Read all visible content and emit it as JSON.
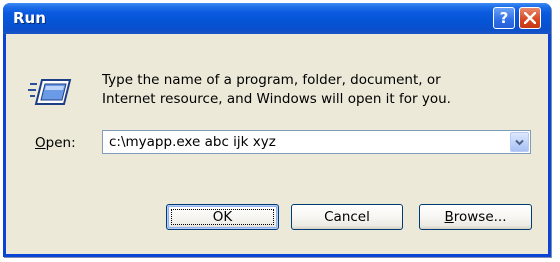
{
  "window": {
    "title": "Run",
    "help_glyph": "?",
    "close_icon": "close-icon"
  },
  "description": {
    "line1": "Type the name of a program, folder, document, or",
    "line2": "Internet resource, and Windows will open it for you."
  },
  "open_field": {
    "label_mnemonic": "O",
    "label_rest": "pen:",
    "value": "c:\\myapp.exe abc ijk xyz"
  },
  "buttons": {
    "ok": "OK",
    "cancel": "Cancel",
    "browse_mnemonic": "B",
    "browse_rest": "rowse..."
  },
  "colors": {
    "titlebar": "#0554d6",
    "client": "#ece9d8",
    "close": "#d5461f"
  }
}
